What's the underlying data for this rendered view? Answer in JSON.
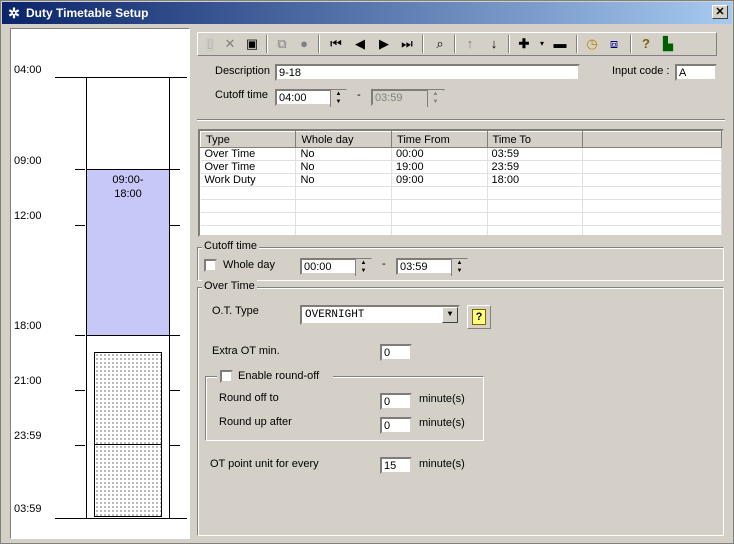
{
  "window": {
    "title": "Duty Timetable Setup",
    "close_label": "✕"
  },
  "timeline": {
    "labels": [
      "04:00",
      "09:00",
      "12:00",
      "18:00",
      "21:00",
      "23:59",
      "03:59"
    ],
    "block_label": "09:00-\n18:00",
    "block_color": "#c8c8f8"
  },
  "toolbar": {
    "icons": [
      "new-icon",
      "delete-icon",
      "save-icon",
      "copy-icon",
      "record-icon",
      "first-icon",
      "prev-icon",
      "next-icon",
      "last-icon",
      "find-icon",
      "up-icon",
      "down-icon",
      "add-icon",
      "remove-icon",
      "clock-icon",
      "properties-icon",
      "help-icon",
      "exit-icon"
    ]
  },
  "form": {
    "description_label": "Description",
    "description_value": "9-18",
    "input_code_label": "Input code :",
    "input_code_value": "A",
    "cutoff_label": "Cutoff time",
    "cutoff_from": "04:00",
    "cutoff_to": "03:59",
    "dash": "-"
  },
  "table": {
    "headers": [
      "Type",
      "Whole day",
      "Time From",
      "Time To"
    ],
    "rows": [
      [
        "Over Time",
        "No",
        "00:00",
        "03:59"
      ],
      [
        "Over Time",
        "No",
        "19:00",
        "23:59"
      ],
      [
        "Work Duty",
        "No",
        "09:00",
        "18:00"
      ]
    ]
  },
  "cutoff_group": {
    "title": "Cutoff time",
    "whole_day_label": "Whole day",
    "from": "00:00",
    "to": "03:59",
    "dash": "-"
  },
  "overtime_group": {
    "title": "Over Time",
    "ot_type_label": "O.T. Type",
    "ot_type_value": "OVERNIGHT",
    "extra_label": "Extra OT min.",
    "extra_value": "0",
    "roundoff_title": "Enable round-off",
    "round_off_label": "Round off to",
    "round_off_value": "0",
    "round_up_label": "Round up after",
    "round_up_value": "0",
    "minutes_label": "minute(s)",
    "point_label": "OT point unit for every",
    "point_value": "15"
  }
}
